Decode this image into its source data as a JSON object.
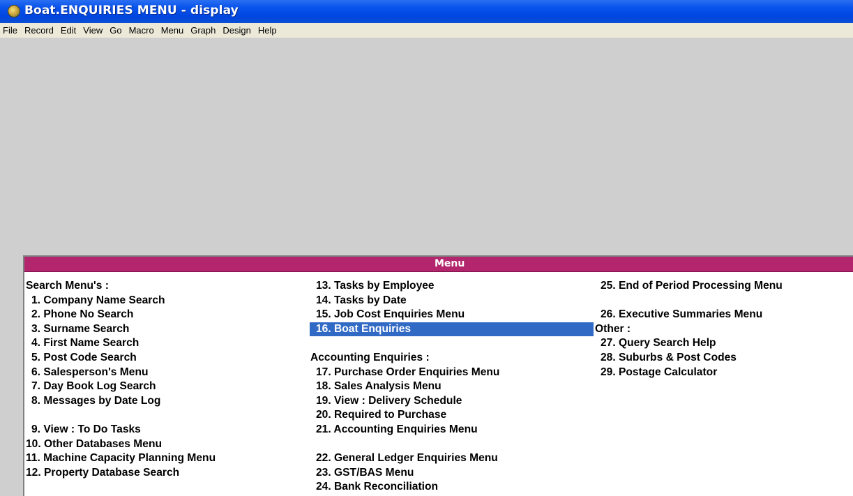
{
  "window": {
    "title": "Boat.ENQUIRIES MENU - display"
  },
  "menubar": [
    "File",
    "Record",
    "Edit",
    "View",
    "Go",
    "Macro",
    "Menu",
    "Graph",
    "Design",
    "Help"
  ],
  "panel": {
    "title": "Menu",
    "columns": [
      [
        {
          "kind": "header",
          "text": "Search Menu's :"
        },
        {
          "kind": "item",
          "text": "1. Company Name Search"
        },
        {
          "kind": "item",
          "text": "2. Phone No Search"
        },
        {
          "kind": "item",
          "text": "3. Surname Search"
        },
        {
          "kind": "item",
          "text": "4. First Name Search"
        },
        {
          "kind": "item",
          "text": "5. Post Code Search"
        },
        {
          "kind": "item",
          "text": "6. Salesperson's Menu"
        },
        {
          "kind": "item",
          "text": "7. Day Book Log Search"
        },
        {
          "kind": "item",
          "text": "8. Messages by Date Log"
        },
        {
          "kind": "blank",
          "text": ""
        },
        {
          "kind": "item",
          "text": "9. View : To Do Tasks"
        },
        {
          "kind": "item",
          "dbl": true,
          "text": "10. Other Databases Menu"
        },
        {
          "kind": "item",
          "dbl": true,
          "text": "11. Machine Capacity Planning Menu"
        },
        {
          "kind": "item",
          "dbl": true,
          "text": "12. Property Database Search"
        }
      ],
      [
        {
          "kind": "item",
          "text": "13. Tasks by Employee"
        },
        {
          "kind": "item",
          "text": "14. Tasks by Date"
        },
        {
          "kind": "item",
          "text": "15. Job Cost Enquiries Menu"
        },
        {
          "kind": "item",
          "text": "16. Boat Enquiries",
          "selected": true
        },
        {
          "kind": "blank",
          "text": ""
        },
        {
          "kind": "header",
          "text": "Accounting Enquiries :"
        },
        {
          "kind": "item",
          "text": "17. Purchase Order Enquiries Menu"
        },
        {
          "kind": "item",
          "text": "18. Sales Analysis Menu"
        },
        {
          "kind": "item",
          "text": "19. View : Delivery Schedule"
        },
        {
          "kind": "item",
          "text": "20. Required to Purchase"
        },
        {
          "kind": "item",
          "text": "21. Accounting Enquiries Menu"
        },
        {
          "kind": "blank",
          "text": ""
        },
        {
          "kind": "item",
          "text": "22. General Ledger Enquiries Menu"
        },
        {
          "kind": "item",
          "text": "23. GST/BAS Menu"
        },
        {
          "kind": "item",
          "text": "24. Bank Reconciliation"
        }
      ],
      [
        {
          "kind": "item",
          "text": "25. End of Period Processing Menu"
        },
        {
          "kind": "blank",
          "text": ""
        },
        {
          "kind": "item",
          "text": "26. Executive Summaries Menu"
        },
        {
          "kind": "header",
          "text": "Other :"
        },
        {
          "kind": "item",
          "text": "27. Query Search Help"
        },
        {
          "kind": "item",
          "text": "28. Suburbs & Post Codes"
        },
        {
          "kind": "item",
          "text": "29. Postage Calculator"
        }
      ]
    ]
  }
}
